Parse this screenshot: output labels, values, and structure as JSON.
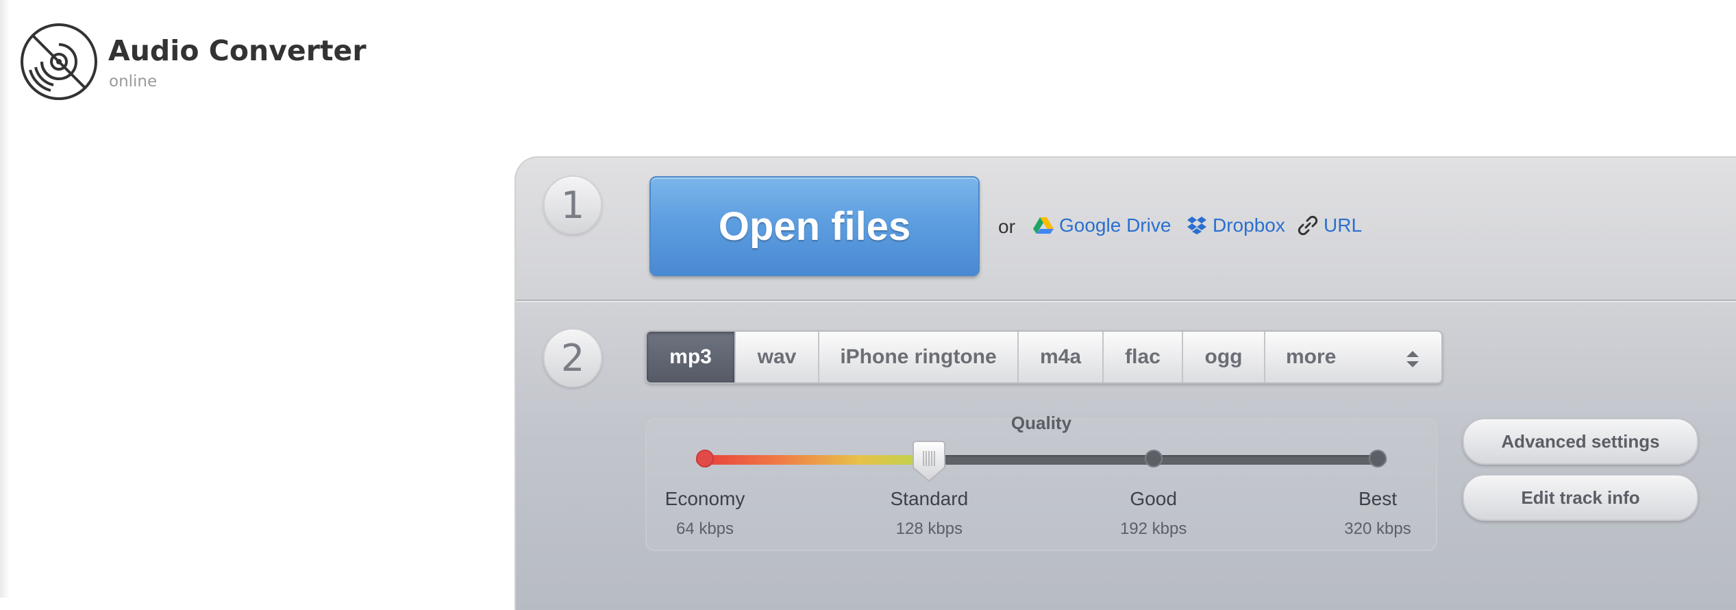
{
  "brand": {
    "title": "Audio Converter",
    "subtitle": "online",
    "logo_icon": "disc-no-sign-icon"
  },
  "step1": {
    "number": "1",
    "open_files_label": "Open files",
    "or_label": "or",
    "sources": [
      {
        "label": "Google Drive",
        "icon": "google-drive-icon"
      },
      {
        "label": "Dropbox",
        "icon": "dropbox-icon"
      },
      {
        "label": "URL",
        "icon": "link-icon"
      }
    ]
  },
  "step2": {
    "number": "2",
    "formats": [
      "mp3",
      "wav",
      "iPhone ringtone",
      "m4a",
      "flac",
      "ogg"
    ],
    "selected_format": "mp3",
    "more_label": "more",
    "quality": {
      "title": "Quality",
      "selected_index": 1,
      "levels": [
        {
          "label": "Economy",
          "bitrate": "64 kbps"
        },
        {
          "label": "Standard",
          "bitrate": "128 kbps"
        },
        {
          "label": "Good",
          "bitrate": "192 kbps"
        },
        {
          "label": "Best",
          "bitrate": "320 kbps"
        }
      ]
    },
    "advanced_settings_label": "Advanced settings",
    "edit_track_info_label": "Edit track info"
  },
  "colors": {
    "accent_blue": "#4a89d3",
    "link_blue": "#2a6fd0",
    "active_tab": "#5f6470",
    "text_dark": "#333333"
  }
}
